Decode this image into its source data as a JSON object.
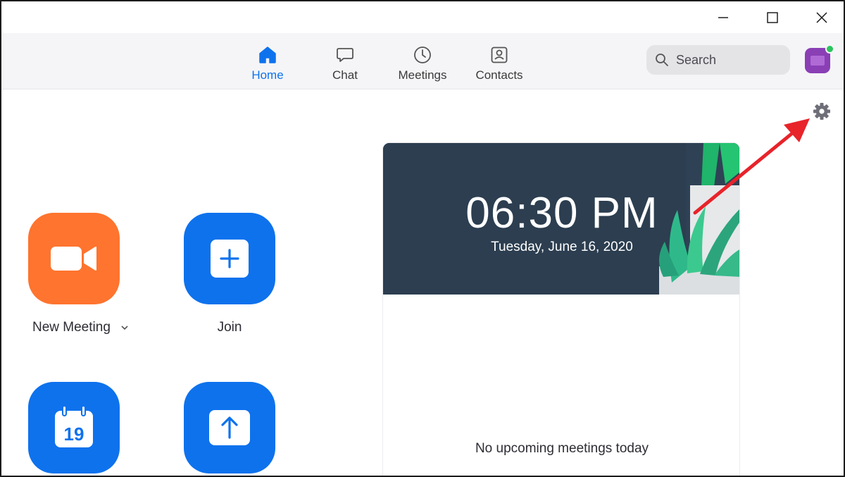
{
  "window": {
    "controls": [
      "minimize-icon",
      "maximize-icon",
      "close-icon"
    ]
  },
  "nav": {
    "tabs": [
      {
        "label": "Home",
        "icon": "home-icon",
        "active": true
      },
      {
        "label": "Chat",
        "icon": "chat-bubble-icon",
        "active": false
      },
      {
        "label": "Meetings",
        "icon": "clock-icon",
        "active": false
      },
      {
        "label": "Contacts",
        "icon": "contact-card-icon",
        "active": false
      }
    ],
    "search": {
      "label": "Search",
      "icon": "search-icon"
    },
    "avatar": {
      "presence": "online"
    }
  },
  "settings": {
    "icon": "gear-icon"
  },
  "actions": [
    {
      "label": "New Meeting",
      "icon": "video-camera-icon",
      "color": "#ff742e"
    },
    {
      "label": "Join",
      "icon": "plus-icon",
      "color": "#0e72ed"
    },
    {
      "label": "",
      "icon": "calendar-icon",
      "calendar_day": "19",
      "color": "#0e72ed"
    },
    {
      "label": "",
      "icon": "share-upload-icon",
      "color": "#0e72ed"
    }
  ],
  "clock": {
    "time": "06:30 PM",
    "date": "Tuesday, June 16, 2020"
  },
  "upcoming": {
    "empty_text": "No upcoming meetings today"
  },
  "colors": {
    "accent": "#0e72ed",
    "orange": "#ff742e",
    "banner": "#2c3e50",
    "annotation_arrow": "#e8232a"
  }
}
